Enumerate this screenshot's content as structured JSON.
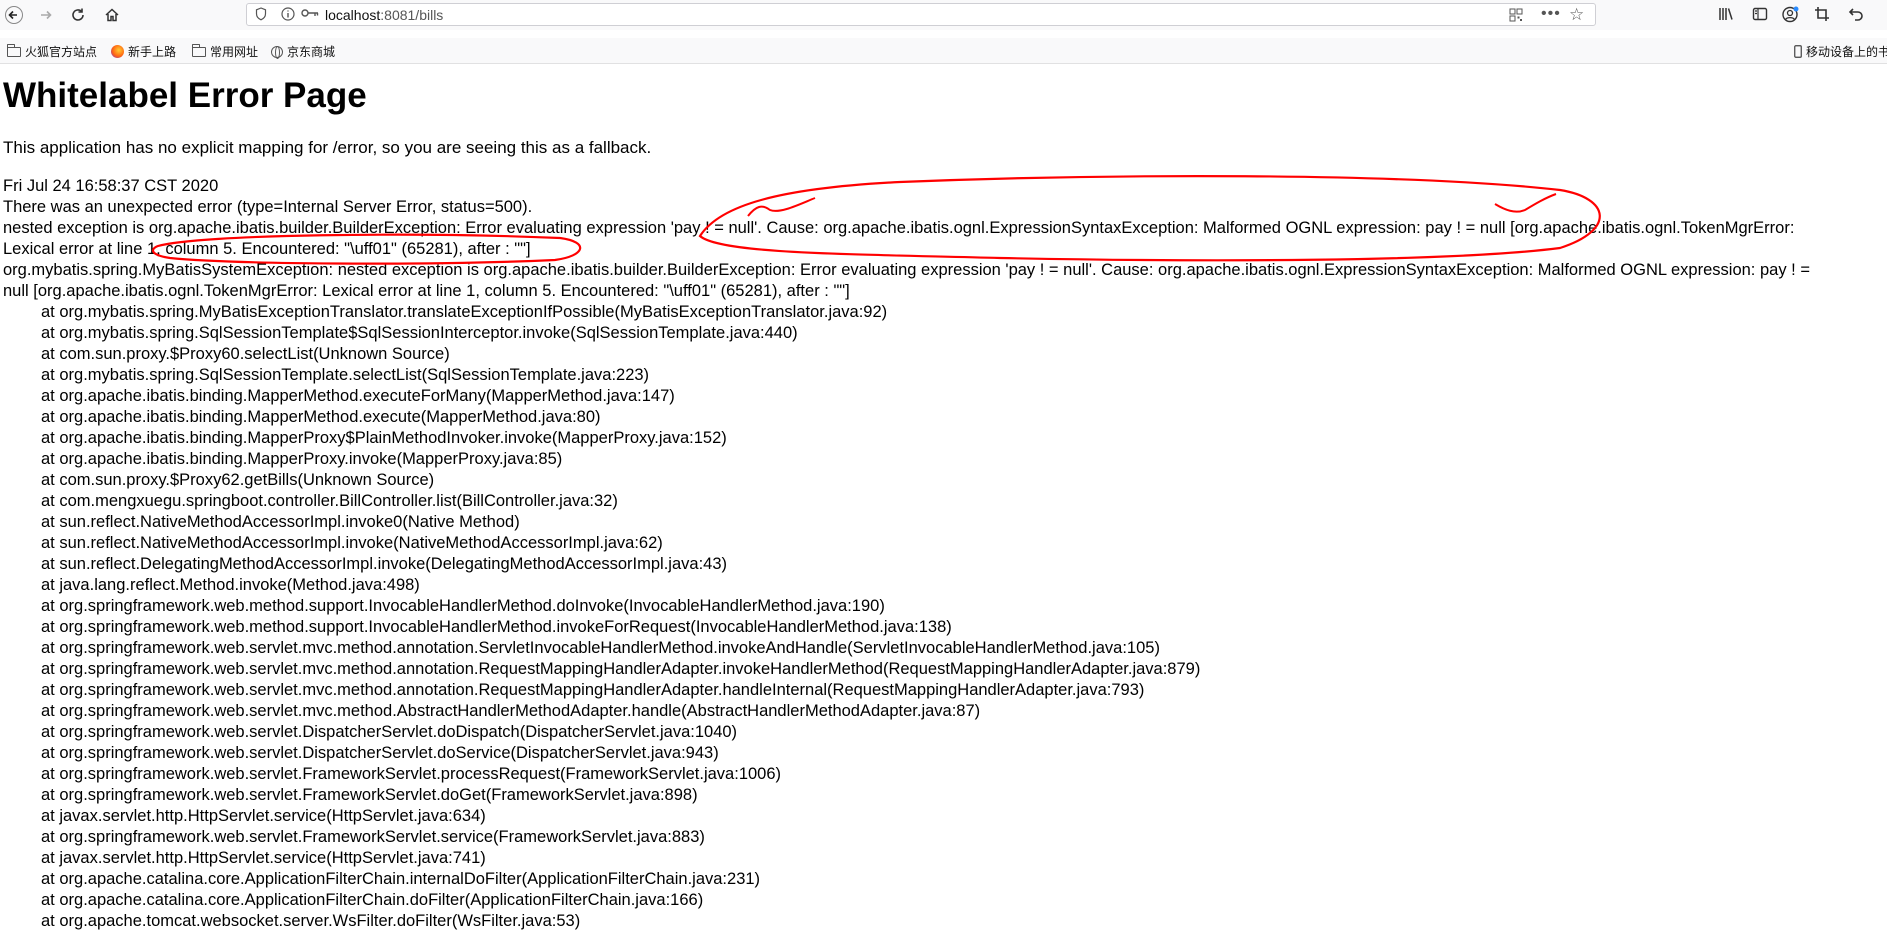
{
  "browser": {
    "url_host": "localhost",
    "url_path": ":8081/bills",
    "bookmarks": [
      "火狐官方站点",
      "新手上路",
      "常用网址",
      "京东商城"
    ],
    "mobile_bookmarks": "移动设备上的书"
  },
  "page": {
    "title": "Whitelabel Error Page",
    "message": "This application has no explicit mapping for /error, so you are seeing this as a fallback.",
    "timestamp": "Fri Jul 24 16:58:37 CST 2020",
    "error_type": "There was an unexpected error (type=Internal Server Error, status=500).",
    "nested_1": "nested exception is org.apache.ibatis.builder.BuilderException: Error evaluating expression 'pay  ! = null'. Cause: org.apache.ibatis.ognl.ExpressionSyntaxException: Malformed OGNL expression: pay  ! = null [org.apache.ibatis.ognl.TokenMgrError:",
    "nested_2": "Lexical error at line 1, column 5. Encountered: \"\\uff01\" (65281), after : \"\"]",
    "exception_1": "org.mybatis.spring.MyBatisSystemException: nested exception is org.apache.ibatis.builder.BuilderException: Error evaluating expression 'pay  ! = null'. Cause: org.apache.ibatis.ognl.ExpressionSyntaxException: Malformed OGNL expression: pay  ! =",
    "exception_2": "null [org.apache.ibatis.ognl.TokenMgrError: Lexical error at line 1, column 5.  Encountered: \"\\uff01\" (65281), after : \"\"]",
    "stack": [
      "at org.mybatis.spring.MyBatisExceptionTranslator.translateExceptionIfPossible(MyBatisExceptionTranslator.java:92)",
      "at org.mybatis.spring.SqlSessionTemplate$SqlSessionInterceptor.invoke(SqlSessionTemplate.java:440)",
      "at com.sun.proxy.$Proxy60.selectList(Unknown Source)",
      "at org.mybatis.spring.SqlSessionTemplate.selectList(SqlSessionTemplate.java:223)",
      "at org.apache.ibatis.binding.MapperMethod.executeForMany(MapperMethod.java:147)",
      "at org.apache.ibatis.binding.MapperMethod.execute(MapperMethod.java:80)",
      "at org.apache.ibatis.binding.MapperProxy$PlainMethodInvoker.invoke(MapperProxy.java:152)",
      "at org.apache.ibatis.binding.MapperProxy.invoke(MapperProxy.java:85)",
      "at com.sun.proxy.$Proxy62.getBills(Unknown Source)",
      "at com.mengxuegu.springboot.controller.BillController.list(BillController.java:32)",
      "at sun.reflect.NativeMethodAccessorImpl.invoke0(Native Method)",
      "at sun.reflect.NativeMethodAccessorImpl.invoke(NativeMethodAccessorImpl.java:62)",
      "at sun.reflect.DelegatingMethodAccessorImpl.invoke(DelegatingMethodAccessorImpl.java:43)",
      "at java.lang.reflect.Method.invoke(Method.java:498)",
      "at org.springframework.web.method.support.InvocableHandlerMethod.doInvoke(InvocableHandlerMethod.java:190)",
      "at org.springframework.web.method.support.InvocableHandlerMethod.invokeForRequest(InvocableHandlerMethod.java:138)",
      "at org.springframework.web.servlet.mvc.method.annotation.ServletInvocableHandlerMethod.invokeAndHandle(ServletInvocableHandlerMethod.java:105)",
      "at org.springframework.web.servlet.mvc.method.annotation.RequestMappingHandlerAdapter.invokeHandlerMethod(RequestMappingHandlerAdapter.java:879)",
      "at org.springframework.web.servlet.mvc.method.annotation.RequestMappingHandlerAdapter.handleInternal(RequestMappingHandlerAdapter.java:793)",
      "at org.springframework.web.servlet.mvc.method.AbstractHandlerMethodAdapter.handle(AbstractHandlerMethodAdapter.java:87)",
      "at org.springframework.web.servlet.DispatcherServlet.doDispatch(DispatcherServlet.java:1040)",
      "at org.springframework.web.servlet.DispatcherServlet.doService(DispatcherServlet.java:943)",
      "at org.springframework.web.servlet.FrameworkServlet.processRequest(FrameworkServlet.java:1006)",
      "at org.springframework.web.servlet.FrameworkServlet.doGet(FrameworkServlet.java:898)",
      "at javax.servlet.http.HttpServlet.service(HttpServlet.java:634)",
      "at org.springframework.web.servlet.FrameworkServlet.service(FrameworkServlet.java:883)",
      "at javax.servlet.http.HttpServlet.service(HttpServlet.java:741)",
      "at org.apache.catalina.core.ApplicationFilterChain.internalDoFilter(ApplicationFilterChain.java:231)",
      "at org.apache.catalina.core.ApplicationFilterChain.doFilter(ApplicationFilterChain.java:166)",
      "at org.apache.tomcat.websocket.server.WsFilter.doFilter(WsFilter.java:53)"
    ]
  },
  "colors": {
    "annotation": "#ff0000",
    "toolbar_bg": "#f9f9fa"
  }
}
